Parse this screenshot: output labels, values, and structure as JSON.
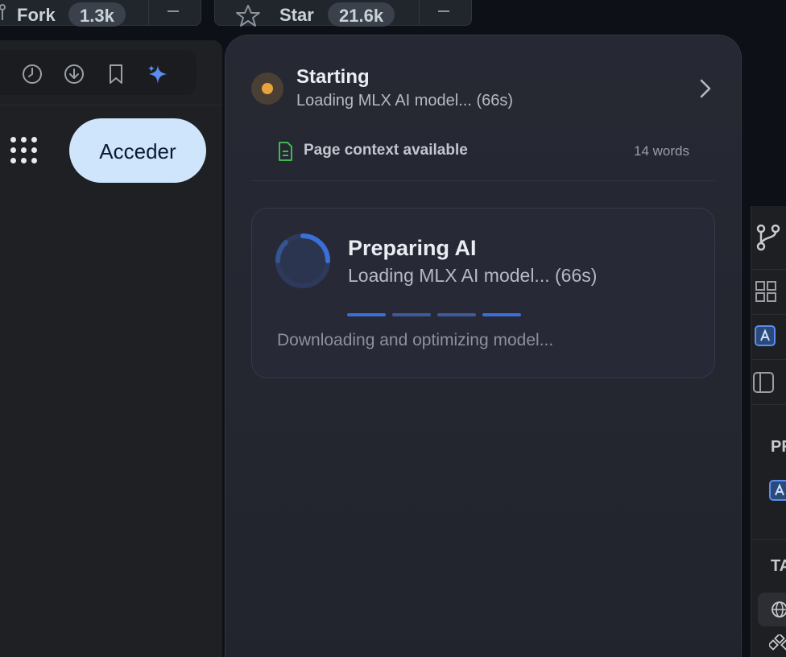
{
  "github": {
    "fork": {
      "label": "Fork",
      "count": "1.3k",
      "icon": "fork-icon"
    },
    "star": {
      "label": "Star",
      "count": "21.6k",
      "icon": "star-icon"
    }
  },
  "browser": {
    "toolbar_icons": [
      "history-icon",
      "download-icon",
      "bookmark-icon",
      "sparkle-icon"
    ],
    "apps_icon": "apps-grid-icon",
    "signin_label": "Acceder",
    "signin_bg": "#cfe5fc"
  },
  "panel": {
    "status": {
      "title": "Starting",
      "subtitle": "Loading MLX AI model... (66s)",
      "dot_color": "#e8a33c"
    },
    "context": {
      "label": "Page context available",
      "words": "14 words",
      "icon": "document-icon",
      "icon_color": "#3fb950"
    },
    "card": {
      "title": "Preparing AI",
      "subtitle": "Loading MLX AI model... (66s)",
      "footer": "Downloading and optimizing model...",
      "accent": "#3b6fd8"
    }
  },
  "ide": {
    "section_1": "PR",
    "section_2": "TA"
  }
}
